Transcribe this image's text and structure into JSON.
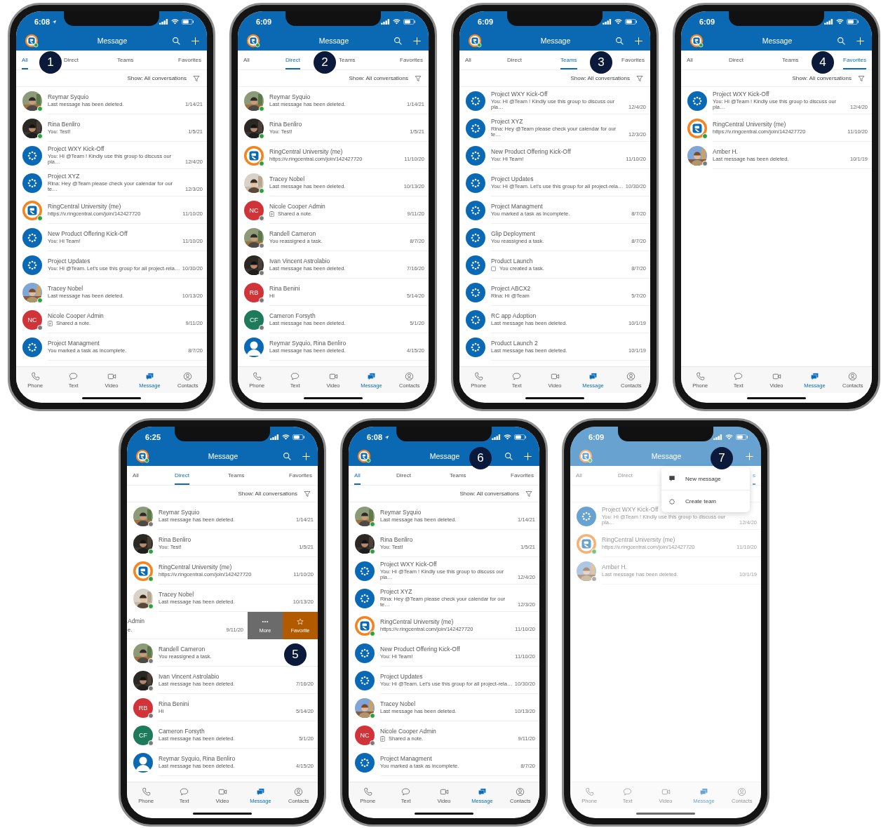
{
  "phones": [
    {
      "status": {
        "time": "6:08",
        "location": true
      },
      "header": {
        "title": "Message",
        "search": true
      },
      "tabs": [
        {
          "label": "All",
          "selected": true
        },
        {
          "label": "Direct",
          "selected": false
        },
        {
          "label": "Teams",
          "selected": false
        },
        {
          "label": "Favorites",
          "selected": false
        }
      ],
      "filter": {
        "label": "Show: All conversations"
      },
      "rows": [
        {
          "kind": "conversation",
          "name": "Reymar Syquio",
          "preview": "Last message has been deleted.",
          "date": "1/14/21",
          "online": true
        },
        {
          "kind": "conversation",
          "name": "Rina Benliro",
          "preview": "You: Test!",
          "date": "1/5/21",
          "online": true
        },
        {
          "kind": "conversation",
          "name": "Project WXY Kick-Off",
          "preview": "You: Hi @Team ! Kindly use this group to discuss our pla…",
          "date": "12/4/20",
          "avatar": {
            "kind": "team"
          }
        },
        {
          "kind": "conversation",
          "name": "Project XYZ",
          "preview": "Rina: Hey @Team please check your calendar for our te…",
          "date": "12/3/20",
          "avatar": {
            "kind": "team"
          }
        },
        {
          "kind": "conversation",
          "name": "RingCentral University (me)",
          "preview": "https://v.ringcentral.com/join/142427720",
          "date": "11/10/20",
          "avatar": {
            "kind": "brand"
          },
          "online": true
        },
        {
          "kind": "conversation",
          "name": "New Product Offering Kick-Off",
          "preview": "You: Hi Team!",
          "date": "11/10/20",
          "avatar": {
            "kind": "team"
          }
        },
        {
          "kind": "conversation",
          "name": "Project Updates",
          "preview": "You: Hi @Team. Let's use this group for all project-rela…",
          "date": "10/30/20",
          "avatar": {
            "kind": "team"
          }
        },
        {
          "kind": "conversation",
          "name": "Tracey Nobel",
          "preview": "Last message has been deleted.",
          "date": "10/13/20",
          "online": true
        },
        {
          "kind": "conversation",
          "name": "Nicole Cooper Admin",
          "preview": "Shared a note.",
          "preview_icon": {
            "kind": "note"
          },
          "date": "9/11/20",
          "avatar": {
            "kind": "initials",
            "text": "NC",
            "color": "#d13438"
          },
          "online": false
        },
        {
          "kind": "conversation",
          "name": "Project Managment",
          "preview": "You marked a task as incomplete.",
          "date": "8/7/20",
          "avatar": {
            "kind": "team"
          }
        }
      ],
      "nav": [
        {
          "label": "Phone",
          "kind": "phone",
          "selected": false
        },
        {
          "label": "Text",
          "kind": "text",
          "selected": false
        },
        {
          "label": "Video",
          "kind": "video",
          "selected": false
        },
        {
          "label": "Message",
          "kind": "message",
          "selected": true
        },
        {
          "label": "Contacts",
          "kind": "contacts",
          "selected": false
        }
      ],
      "badge": {
        "label": "1",
        "kind": "all-direct"
      }
    },
    {
      "status": {
        "time": "6:09"
      },
      "header": {
        "title": "Message",
        "search": true
      },
      "tabs": [
        {
          "label": "All",
          "selected": false
        },
        {
          "label": "Direct",
          "selected": true
        },
        {
          "label": "Teams",
          "selected": false
        },
        {
          "label": "Favorites",
          "selected": false
        }
      ],
      "filter": {
        "label": "Show: All conversations"
      },
      "rows": [
        {
          "kind": "conversation",
          "name": "Reymar Syquio",
          "preview": "Last message has been deleted.",
          "date": "1/14/21",
          "online": true
        },
        {
          "kind": "conversation",
          "name": "Rina Benliro",
          "preview": "You: Test!",
          "date": "1/5/21",
          "online": true
        },
        {
          "kind": "conversation",
          "name": "RingCentral University (me)",
          "preview": "https://v.ringcentral.com/join/142427720",
          "date": "11/10/20",
          "avatar": {
            "kind": "brand"
          },
          "online": true
        },
        {
          "kind": "conversation",
          "name": "Tracey Nobel",
          "preview": "Last message has been deleted.",
          "date": "10/13/20",
          "online": true
        },
        {
          "kind": "conversation",
          "name": "Nicole Cooper Admin",
          "preview": "Shared a note.",
          "preview_icon": {
            "kind": "note"
          },
          "date": "9/11/20",
          "avatar": {
            "kind": "initials",
            "text": "NC",
            "color": "#d13438"
          },
          "online": false
        },
        {
          "kind": "conversation",
          "name": "Randell Cameron",
          "preview": "You reassigned a task.",
          "date": "8/7/20",
          "online": false
        },
        {
          "kind": "conversation",
          "name": "Ivan Vincent Astrolabio",
          "preview": "Last message has been deleted.",
          "date": "7/16/20",
          "online": false
        },
        {
          "kind": "conversation",
          "name": "Rina Benini",
          "preview": "Hi",
          "date": "5/14/20",
          "avatar": {
            "kind": "initials",
            "text": "RB",
            "color": "#d13438"
          },
          "online": false
        },
        {
          "kind": "conversation",
          "name": "Cameron Forsyth",
          "preview": "Last message has been deleted.",
          "date": "5/1/20",
          "avatar": {
            "kind": "initials",
            "text": "CF",
            "color": "#1d7a5a"
          },
          "online": false
        },
        {
          "kind": "conversation",
          "name": "Reymar Syquio, Rina Benliro",
          "preview": "Last message has been deleted.",
          "date": "4/15/20",
          "avatar": {
            "kind": "group"
          }
        }
      ],
      "nav": [
        {
          "label": "Phone",
          "kind": "phone",
          "selected": false
        },
        {
          "label": "Text",
          "kind": "text",
          "selected": false
        },
        {
          "label": "Video",
          "kind": "video",
          "selected": false
        },
        {
          "label": "Message",
          "kind": "message",
          "selected": true
        },
        {
          "label": "Contacts",
          "kind": "contacts",
          "selected": false
        }
      ],
      "badge": {
        "label": "2",
        "kind": "direct-teams"
      }
    },
    {
      "status": {
        "time": "6:09"
      },
      "header": {
        "title": "Message",
        "search": true
      },
      "tabs": [
        {
          "label": "All",
          "selected": false
        },
        {
          "label": "Direct",
          "selected": false
        },
        {
          "label": "Teams",
          "selected": true
        },
        {
          "label": "Favorites",
          "selected": false
        }
      ],
      "filter": {
        "label": "Show: All conversations"
      },
      "rows": [
        {
          "kind": "conversation",
          "name": "Project WXY Kick-Off",
          "preview": "You: Hi @Team ! Kindly use this group to discuss our pla…",
          "date": "12/4/20",
          "avatar": {
            "kind": "team"
          }
        },
        {
          "kind": "conversation",
          "name": "Project XYZ",
          "preview": "Rina: Hey @Team please check your calendar for our te…",
          "date": "12/3/20",
          "avatar": {
            "kind": "team"
          }
        },
        {
          "kind": "conversation",
          "name": "New Product Offering Kick-Off",
          "preview": "You: Hi Team!",
          "date": "11/10/20",
          "avatar": {
            "kind": "team"
          }
        },
        {
          "kind": "conversation",
          "name": "Project Updates",
          "preview": "You: Hi @Team. Let's use this group for all project-rela…",
          "date": "10/30/20",
          "avatar": {
            "kind": "team"
          }
        },
        {
          "kind": "conversation",
          "name": "Project Managment",
          "preview": "You marked a task as incomplete.",
          "date": "8/7/20",
          "avatar": {
            "kind": "team"
          }
        },
        {
          "kind": "conversation",
          "name": "Glip Deployment",
          "preview": "You reassigned a task.",
          "date": "8/7/20",
          "avatar": {
            "kind": "team"
          }
        },
        {
          "kind": "conversation",
          "name": "Product Launch",
          "preview": "You created a task.",
          "preview_icon": {
            "kind": "task"
          },
          "date": "8/7/20",
          "avatar": {
            "kind": "team"
          }
        },
        {
          "kind": "conversation",
          "name": "Project ABCX2",
          "preview": "Rina: Hi @Team",
          "date": "5/7/20",
          "avatar": {
            "kind": "team"
          }
        },
        {
          "kind": "conversation",
          "name": "RC app Adoption",
          "preview": "Last message has been deleted.",
          "date": "10/1/19",
          "avatar": {
            "kind": "team"
          }
        },
        {
          "kind": "conversation",
          "name": "Product Launch 2",
          "preview": "Last message has been deleted.",
          "date": "10/1/19",
          "avatar": {
            "kind": "team"
          }
        }
      ],
      "nav": [
        {
          "label": "Phone",
          "kind": "phone",
          "selected": false
        },
        {
          "label": "Text",
          "kind": "text",
          "selected": false
        },
        {
          "label": "Video",
          "kind": "video",
          "selected": false
        },
        {
          "label": "Message",
          "kind": "message",
          "selected": true
        },
        {
          "label": "Contacts",
          "kind": "contacts",
          "selected": false
        }
      ],
      "badge": {
        "label": "3",
        "kind": "teams-favorites"
      }
    },
    {
      "status": {
        "time": "6:09"
      },
      "header": {
        "title": "Message",
        "search": true
      },
      "tabs": [
        {
          "label": "All",
          "selected": false
        },
        {
          "label": "Direct",
          "selected": false
        },
        {
          "label": "Teams",
          "selected": false
        },
        {
          "label": "Favorites",
          "selected": true
        }
      ],
      "filter": {
        "label": "Show: All conversations"
      },
      "rows": [
        {
          "kind": "conversation",
          "name": "Project WXY Kick-Off",
          "preview": "You: Hi @Team ! Kindly use this group to discuss our pla…",
          "date": "12/4/20",
          "avatar": {
            "kind": "team"
          }
        },
        {
          "kind": "conversation",
          "name": "RingCentral University (me)",
          "preview": "https://v.ringcentral.com/join/142427720",
          "date": "11/10/20",
          "avatar": {
            "kind": "brand"
          },
          "online": true
        },
        {
          "kind": "conversation",
          "name": "Amber H.",
          "preview": "Last message has been deleted.",
          "date": "10/1/19",
          "online": false
        }
      ],
      "nav": [
        {
          "label": "Phone",
          "kind": "phone",
          "selected": false
        },
        {
          "label": "Text",
          "kind": "text",
          "selected": false
        },
        {
          "label": "Video",
          "kind": "video",
          "selected": false
        },
        {
          "label": "Message",
          "kind": "message",
          "selected": true
        },
        {
          "label": "Contacts",
          "kind": "contacts",
          "selected": false
        }
      ],
      "badge": {
        "label": "4",
        "kind": "teams-favorites"
      }
    },
    {
      "status": {
        "time": "6:25"
      },
      "header": {
        "title": "Message",
        "search": true
      },
      "tabs": [
        {
          "label": "All",
          "selected": false
        },
        {
          "label": "Direct",
          "selected": true
        },
        {
          "label": "Teams",
          "selected": false
        },
        {
          "label": "Favorites",
          "selected": false
        }
      ],
      "filter": {
        "label": "Show: All conversations"
      },
      "rows": [
        {
          "kind": "conversation",
          "name": "Reymar Syquio",
          "preview": "Last message has been deleted.",
          "date": "1/14/21",
          "online": false
        },
        {
          "kind": "conversation",
          "name": "Rina Benliro",
          "preview": "You: Test!",
          "date": "1/5/21",
          "online": true
        },
        {
          "kind": "conversation",
          "name": "RingCentral University (me)",
          "preview": "https://v.ringcentral.com/join/142427720",
          "date": "11/10/20",
          "avatar": {
            "kind": "brand"
          },
          "online": true
        },
        {
          "kind": "conversation",
          "name": "Tracey Nobel",
          "preview": "Last message has been deleted.",
          "date": "10/13/20",
          "online": true
        },
        {
          "kind": "swiped",
          "name": "Admin",
          "preview": "e.",
          "date": "9/11/20",
          "actions": [
            {
              "label": "More",
              "kind": "more"
            },
            {
              "label": "Favorite",
              "kind": "star"
            }
          ]
        },
        {
          "kind": "conversation",
          "name": "Randell Cameron",
          "preview": "You reassigned a task.",
          "online": false
        },
        {
          "kind": "conversation",
          "name": "Ivan Vincent Astrolabio",
          "preview": "Last message has been deleted.",
          "date": "7/16/20",
          "online": false
        },
        {
          "kind": "conversation",
          "name": "Rina Benini",
          "preview": "Hi",
          "date": "5/14/20",
          "avatar": {
            "kind": "initials",
            "text": "RB",
            "color": "#d13438"
          },
          "online": false
        },
        {
          "kind": "conversation",
          "name": "Cameron Forsyth",
          "preview": "Last message has been deleted.",
          "date": "5/1/20",
          "avatar": {
            "kind": "initials",
            "text": "CF",
            "color": "#1d7a5a"
          },
          "online": false
        },
        {
          "kind": "conversation",
          "name": "Reymar Syquio, Rina Benliro",
          "preview": "Last message has been deleted.",
          "date": "4/15/20",
          "avatar": {
            "kind": "group"
          }
        }
      ],
      "nav": [
        {
          "label": "Phone",
          "kind": "phone",
          "selected": false
        },
        {
          "label": "Text",
          "kind": "text",
          "selected": false
        },
        {
          "label": "Video",
          "kind": "video",
          "selected": false
        },
        {
          "label": "Message",
          "kind": "message",
          "selected": true
        },
        {
          "label": "Contacts",
          "kind": "contacts",
          "selected": false
        }
      ],
      "badge": {
        "label": "5",
        "kind": "swipe"
      }
    },
    {
      "status": {
        "time": "6:08",
        "location": true
      },
      "header": {
        "title": "Message",
        "search": true
      },
      "tabs": [
        {
          "label": "All",
          "selected": true
        },
        {
          "label": "Direct",
          "selected": false
        },
        {
          "label": "Teams",
          "selected": false
        },
        {
          "label": "Favorites",
          "selected": false
        }
      ],
      "filter": {
        "label": "Show: All conversations"
      },
      "rows": [
        {
          "kind": "conversation",
          "name": "Reymar Syquio",
          "preview": "Last message has been deleted.",
          "date": "1/14/21",
          "online": true
        },
        {
          "kind": "conversation",
          "name": "Rina Benliro",
          "preview": "You: Test!",
          "date": "1/5/21",
          "online": true
        },
        {
          "kind": "conversation",
          "name": "Project WXY Kick-Off",
          "preview": "You: Hi @Team ! Kindly use this group to discuss our pla…",
          "date": "12/4/20",
          "avatar": {
            "kind": "team"
          }
        },
        {
          "kind": "conversation",
          "name": "Project XYZ",
          "preview": "Rina: Hey @Team please check your calendar for our te…",
          "date": "12/3/20",
          "avatar": {
            "kind": "team"
          }
        },
        {
          "kind": "conversation",
          "name": "RingCentral University (me)",
          "preview": "https://v.ringcentral.com/join/142427720",
          "date": "11/10/20",
          "avatar": {
            "kind": "brand"
          },
          "online": true
        },
        {
          "kind": "conversation",
          "name": "New Product Offering Kick-Off",
          "preview": "You: Hi Team!",
          "date": "11/10/20",
          "avatar": {
            "kind": "team"
          }
        },
        {
          "kind": "conversation",
          "name": "Project Updates",
          "preview": "You: Hi @Team. Let's use this group for all project-rela…",
          "date": "10/30/20",
          "avatar": {
            "kind": "team"
          }
        },
        {
          "kind": "conversation",
          "name": "Tracey Nobel",
          "preview": "Last message has been deleted.",
          "date": "10/13/20",
          "online": true
        },
        {
          "kind": "conversation",
          "name": "Nicole Cooper Admin",
          "preview": "Shared a note.",
          "preview_icon": {
            "kind": "note"
          },
          "date": "9/11/20",
          "avatar": {
            "kind": "initials",
            "text": "NC",
            "color": "#d13438"
          },
          "online": false
        },
        {
          "kind": "conversation",
          "name": "Project Managment",
          "preview": "You marked a task as incomplete.",
          "date": "8/7/20",
          "avatar": {
            "kind": "team"
          }
        }
      ],
      "nav": [
        {
          "label": "Phone",
          "kind": "phone",
          "selected": false
        },
        {
          "label": "Text",
          "kind": "text",
          "selected": false
        },
        {
          "label": "Video",
          "kind": "video",
          "selected": false
        },
        {
          "label": "Message",
          "kind": "message",
          "selected": true
        },
        {
          "label": "Contacts",
          "kind": "contacts",
          "selected": false
        }
      ],
      "badge": {
        "label": "6",
        "kind": "search"
      }
    },
    {
      "status": {
        "time": "6:09"
      },
      "header": {
        "title": "Message"
      },
      "dimmed": true,
      "tabs": [
        {
          "label": "All",
          "selected": false
        },
        {
          "label": "Direct",
          "selected": false
        },
        {
          "label": "s",
          "selected": true
        }
      ],
      "rows": [
        {
          "kind": "conversation",
          "name": "Project WXY Kick-Off",
          "preview": "You: Hi @Team ! Kindly use this group to discuss our pla…",
          "date": "12/4/20",
          "avatar": {
            "kind": "team"
          }
        },
        {
          "kind": "conversation",
          "name": "RingCentral University (me)",
          "preview": "https://v.ringcentral.com/join/142427720",
          "date": "11/10/20",
          "avatar": {
            "kind": "brand"
          },
          "online": true
        },
        {
          "kind": "conversation",
          "name": "Amber H.",
          "preview": "Last message has been deleted.",
          "date": "10/1/19",
          "online": false
        }
      ],
      "menu": {
        "items": [
          {
            "label": "New message",
            "kind": "message"
          },
          {
            "label": "Create team",
            "kind": "team"
          }
        ]
      },
      "nav": [
        {
          "label": "Phone",
          "kind": "phone",
          "selected": false
        },
        {
          "label": "Text",
          "kind": "text",
          "selected": false
        },
        {
          "label": "Video",
          "kind": "video",
          "selected": false
        },
        {
          "label": "Message",
          "kind": "message",
          "selected": true
        },
        {
          "label": "Contacts",
          "kind": "contacts",
          "selected": false
        }
      ],
      "badge": {
        "label": "7",
        "kind": "plus"
      }
    }
  ]
}
